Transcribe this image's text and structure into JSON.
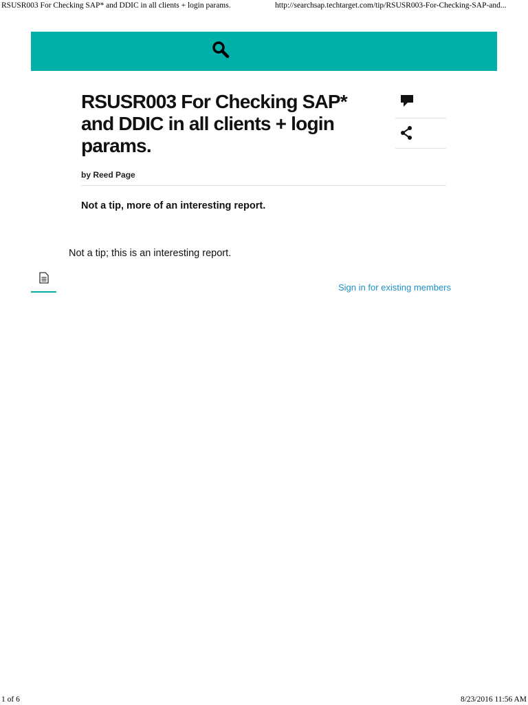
{
  "print_header": {
    "title": "RSUSR003 For Checking SAP* and DDIC in all clients + login params.",
    "url": "http://searchsap.techtarget.com/tip/RSUSR003-For-Checking-SAP-and..."
  },
  "header": {
    "search_icon": "search-icon",
    "brand_color": "#00b0a9"
  },
  "article": {
    "title": "RSUSR003 For Checking SAP* and DDIC in all clients + login params.",
    "byline": "by Reed Page",
    "subtitle": "Not a tip, more of an interesting report.",
    "body": "Not a tip; this is an interesting report."
  },
  "tools": {
    "comment_icon": "comment-icon",
    "share_icon": "share-icon"
  },
  "auth": {
    "sign_in_label": "Sign in for existing members",
    "link_color": "#1d8fc4"
  },
  "tabs": {
    "document_icon": "document-icon"
  },
  "print_footer": {
    "page": "1 of 6",
    "datetime": "8/23/2016 11:56 AM"
  }
}
